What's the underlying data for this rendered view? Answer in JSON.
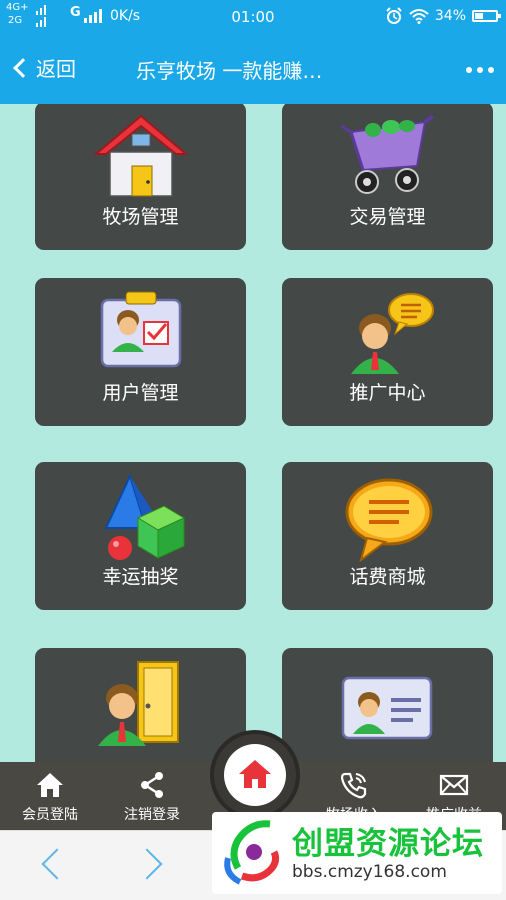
{
  "status_bar": {
    "network_top": "4G+",
    "network_bottom": "2G",
    "signal2": "G",
    "speed": "0K/s",
    "time": "01:00",
    "battery": "34%"
  },
  "nav": {
    "back_label": "返回",
    "title": "乐亨牧场 一款能赚…"
  },
  "tiles": [
    {
      "label": "牧场管理",
      "icon": "house-icon"
    },
    {
      "label": "交易管理",
      "icon": "shopping-cart-icon"
    },
    {
      "label": "用户管理",
      "icon": "user-id-card-icon"
    },
    {
      "label": "推广中心",
      "icon": "user-chat-icon"
    },
    {
      "label": "幸运抽奖",
      "icon": "shapes-icon"
    },
    {
      "label": "话费商城",
      "icon": "speech-bubble-icon"
    },
    {
      "label": "",
      "icon": "user-door-icon"
    },
    {
      "label": "",
      "icon": "contact-card-icon"
    }
  ],
  "tabbar": {
    "items": [
      {
        "label": "会员登陆",
        "icon": "home-icon"
      },
      {
        "label": "注销登录",
        "icon": "share-icon"
      },
      {
        "label": "",
        "icon": "home-icon"
      },
      {
        "label": "牧场收入",
        "icon": "phone-icon"
      },
      {
        "label": "推广收益",
        "icon": "mail-icon"
      }
    ]
  },
  "watermark": {
    "text": "创盟资源论坛",
    "url": "bbs.cmzy168.com"
  },
  "colors": {
    "header": "#1aa8e8",
    "background": "#b2eadf",
    "tile": "#444846",
    "tabbar": "#4a4843",
    "accent_red": "#e8333a"
  }
}
